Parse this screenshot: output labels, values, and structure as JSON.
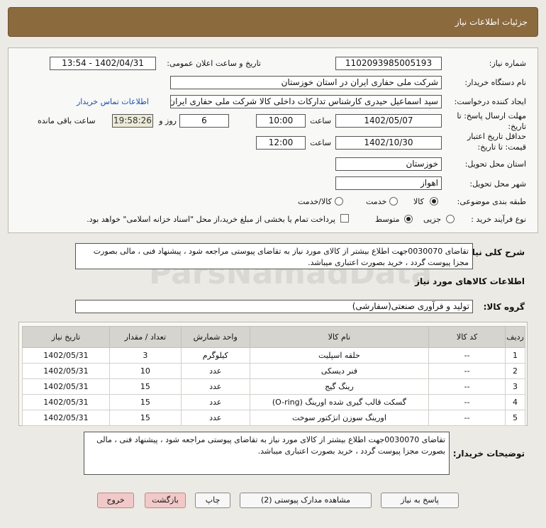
{
  "header": {
    "title": "جزئیات اطلاعات نیاز"
  },
  "form": {
    "need_number_label": "شماره نیاز:",
    "need_number": "1102093985005193",
    "announce_label": "تاریخ و ساعت اعلان عمومی:",
    "announce_value": "1402/04/31 - 13:54",
    "buyer_org_label": "نام دستگاه خریدار:",
    "buyer_org": "شرکت ملی حفاری ایران در استان خوزستان",
    "requester_label": "ایجاد کننده درخواست:",
    "requester": "سید اسماعیل حیدری کارشناس تدارکات داخلی کالا شرکت ملی حفاری ایران د",
    "contact_link": "اطلاعات تماس خریدار",
    "deadline_label_1": "مهلت ارسال پاسخ: تا",
    "deadline_label_2": "تاریخ:",
    "deadline_date": "1402/05/07",
    "time_label": "ساعت",
    "deadline_time": "10:00",
    "days_value": "6",
    "days_label": "روز و",
    "remaining_time": "19:58:26",
    "remaining_label": "ساعت باقی مانده",
    "validity_label_1": "حداقل تاریخ اعتبار",
    "validity_label_2": "قیمت: تا تاریخ:",
    "validity_date": "1402/10/30",
    "validity_time_label": "ساعت",
    "validity_time": "12:00",
    "province_label": "استان محل تحویل:",
    "province": "خوزستان",
    "city_label": "شهر محل تحویل:",
    "city": "اهواز",
    "category_label": "طبقه بندی موضوعی:",
    "category_options": [
      "کالا",
      "خدمت",
      "کالا/خدمت"
    ],
    "category_selected": "کالا",
    "process_label": "نوع فرآیند خرید :",
    "process_options": [
      "جزیی",
      "متوسط"
    ],
    "process_selected": "متوسط",
    "payment_note": "پرداخت تمام یا بخشی از مبلغ خرید،از محل \"اسناد خزانه اسلامی\" خواهد بود."
  },
  "description": {
    "label": "شرح کلی نیاز:",
    "text": "تقاضای 0030070جهت اطلاع بیشتر از کالای مورد نیاز به تقاضای پیوستی مراجعه شود ، پیشنهاد فنی ، مالی بصورت مجزا پیوست گردد ، خرید بصورت اعتباری میباشد."
  },
  "goods": {
    "section_title": "اطلاعات کالاهای مورد نیاز",
    "group_label": "گروه کالا:",
    "group_value": "تولید و فرآوری صنعتی(سفارشی)",
    "columns": [
      "ردیف",
      "کد کالا",
      "نام کالا",
      "واحد شمارش",
      "تعداد / مقدار",
      "تاریخ نیاز"
    ],
    "rows": [
      {
        "idx": "1",
        "code": "--",
        "name": "حلقه اسپلیت",
        "unit": "کیلوگرم",
        "qty": "3",
        "date": "1402/05/31"
      },
      {
        "idx": "2",
        "code": "--",
        "name": "فنر دیسکی",
        "unit": "عدد",
        "qty": "10",
        "date": "1402/05/31"
      },
      {
        "idx": "3",
        "code": "--",
        "name": "رینگ گیج",
        "unit": "عدد",
        "qty": "15",
        "date": "1402/05/31"
      },
      {
        "idx": "4",
        "code": "--",
        "name": "گسکت قالب گیری شده اورینگ (O-ring)",
        "unit": "عدد",
        "qty": "15",
        "date": "1402/05/31"
      },
      {
        "idx": "5",
        "code": "--",
        "name": "اورینگ سوزن انژکتور سوخت",
        "unit": "عدد",
        "qty": "15",
        "date": "1402/05/31"
      }
    ]
  },
  "buyer_notes": {
    "label": "توضیحات خریدار:",
    "text": "تقاضای 0030070جهت اطلاع بیشتر از کالای مورد نیاز به تقاضای پیوستی مراجعه شود ، پیشنهاد فنی ، مالی بصورت مجزا پیوست گردد ، خرید بصورت اعتباری میباشد."
  },
  "buttons": {
    "reply": "پاسخ به نیاز",
    "attachments": "مشاهده مدارک پیوستی (2)",
    "print": "چاپ",
    "back": "بازگشت",
    "exit": "خروج"
  },
  "watermark": "ParsNamadData"
}
